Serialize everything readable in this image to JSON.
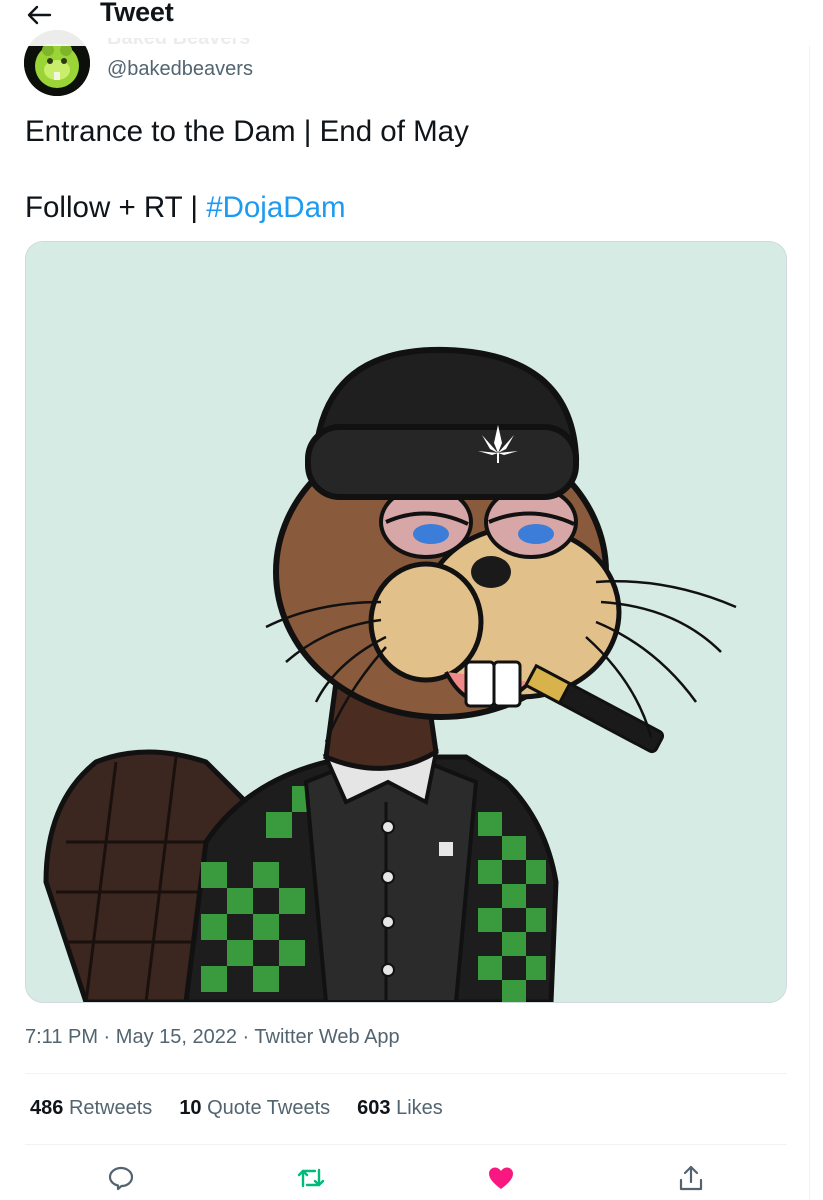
{
  "header": {
    "title": "Tweet",
    "back_icon": "arrow-left-icon"
  },
  "author": {
    "name": "Baked Beavers",
    "handle": "@bakedbeavers",
    "avatar_icon": "beaver-avatar"
  },
  "tweet": {
    "line1": "Entrance to the Dam | End of May",
    "line2_prefix": "Follow + RT | ",
    "hashtag": "#DojaDam",
    "hashtag_color": "#1d9bf0",
    "media_icon": "beaver-nft-illustration"
  },
  "meta": {
    "time": "7:11 PM",
    "sep1": " · ",
    "date": "May 15, 2022",
    "sep2": " · ",
    "source": "Twitter Web App"
  },
  "stats": {
    "retweets_count": "486",
    "retweets_label": "Retweets",
    "quotes_count": "10",
    "quotes_label": "Quote Tweets",
    "likes_count": "603",
    "likes_label": "Likes"
  },
  "actions": [
    {
      "icon": "reply-icon",
      "color": "#536471"
    },
    {
      "icon": "retweet-icon",
      "color": "#00ba7c"
    },
    {
      "icon": "heart-icon",
      "color": "#f91880"
    },
    {
      "icon": "share-icon",
      "color": "#536471"
    }
  ]
}
